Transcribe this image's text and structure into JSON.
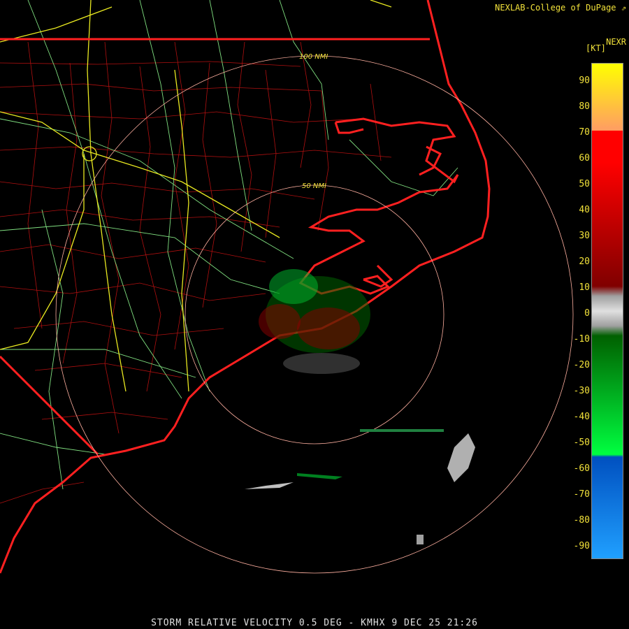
{
  "header": {
    "credit": "NEXLAB-College of DuPage",
    "credit_icon": "external-link-icon",
    "product": "NEXR",
    "unit": "[KT]"
  },
  "range_rings": [
    {
      "label": "50 NMI"
    },
    {
      "label": "100 NMI"
    }
  ],
  "scale": {
    "ticks": [
      "90",
      "80",
      "70",
      "60",
      "50",
      "40",
      "30",
      "20",
      "10",
      "0",
      "-10",
      "-20",
      "-30",
      "-40",
      "-50",
      "-60",
      "-70",
      "-80",
      "-90"
    ],
    "colors": {
      "yellow": "#ffff00",
      "orange": "#ffa060",
      "red": "#ff0000",
      "dark_red": "#800000",
      "gray": "#a0a0a0",
      "dark_green": "#006000",
      "green": "#00ff40",
      "blue": "#0050c0",
      "light_blue": "#20a0ff"
    }
  },
  "map_colors": {
    "state_border": "#ff2020",
    "county_lines": "#b01010",
    "highways": "#80e080",
    "interstates": "#e8e820",
    "range_rings": "#ffb0a0"
  },
  "footer": {
    "caption": "STORM RELATIVE VELOCITY 0.5 DEG - KMHX 9 DEC 25 21:26"
  }
}
